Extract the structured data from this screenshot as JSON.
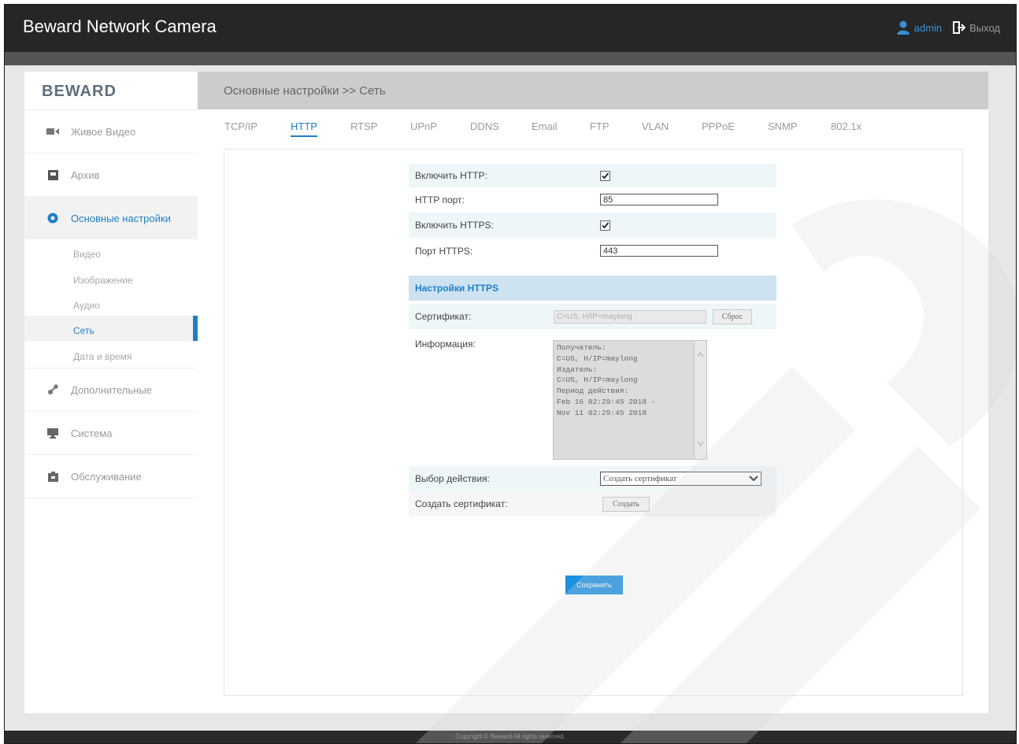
{
  "app": {
    "title": "Beward Network Camera",
    "user_name": "admin",
    "logout_label": "Выход",
    "logo_text": "BEWARD"
  },
  "sidebar": {
    "items": [
      {
        "label": "Живое Видео",
        "icon": "video-camera-icon"
      },
      {
        "label": "Архив",
        "icon": "archive-icon"
      },
      {
        "label": "Основные настройки",
        "icon": "gear-icon"
      },
      {
        "label": "Дополнительные",
        "icon": "tools-icon"
      },
      {
        "label": "Система",
        "icon": "monitor-icon"
      },
      {
        "label": "Обслуживание",
        "icon": "maintenance-icon"
      }
    ],
    "sub_items": [
      "Видео",
      "Изображение",
      "Аудио",
      "Сеть",
      "Дата и время"
    ]
  },
  "header": {
    "breadcrumb": "Основные настройки >> Сеть"
  },
  "tabs": [
    "TCP/IP",
    "HTTP",
    "RTSP",
    "UPnP",
    "DDNS",
    "Email",
    "FTP",
    "VLAN",
    "PPPoE",
    "SNMP",
    "802.1x"
  ],
  "form": {
    "enable_http_label": "Включить HTTP:",
    "enable_http_checked": true,
    "http_port_label": "HTTP порт:",
    "http_port_value": "85",
    "enable_https_label": "Включить HTTPS:",
    "enable_https_checked": true,
    "https_port_label": "Порт HTTPS:",
    "https_port_value": "443",
    "https_section_title": "Настройки HTTPS",
    "certificate_label": "Сертификат:",
    "certificate_value": "C=US, H/IP=maylong",
    "certificate_button": "Сброс",
    "info_label": "Информация:",
    "info_lines": [
      "Получатель:",
      "C=US, H/IP=maylong",
      "Издатель:",
      "C=US, H/IP=maylong",
      "Период действия:",
      "Feb 16 02:29:45 2018 -",
      "Nov 11 02:29:45 2018"
    ],
    "action_label": "Выбор действия:",
    "action_selected": "Создать сертификат",
    "create_cert_label": "Создать сертификат:",
    "create_button": "Создать",
    "save_button": "Сохранить"
  },
  "footer": {
    "copyright": "Copyright © Beward All rights reserved."
  },
  "colors": {
    "accent": "#1e7fcb",
    "topbar": "#262626",
    "save_button": "#1e90e0",
    "section_header": "#cde3f1",
    "row_alt": "#eef6fa"
  }
}
